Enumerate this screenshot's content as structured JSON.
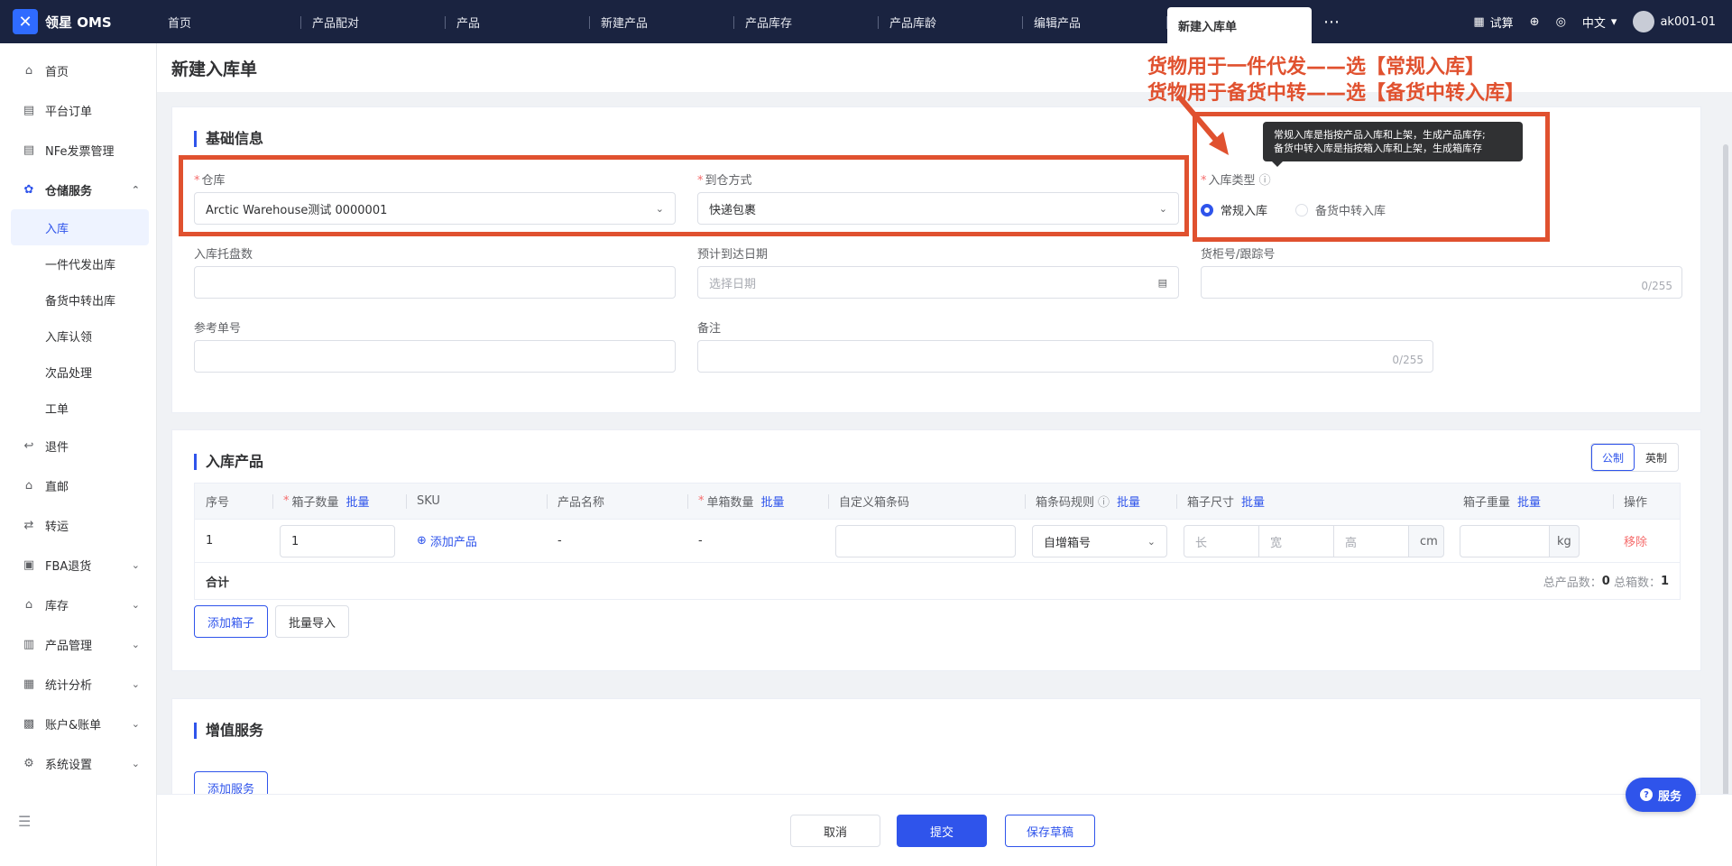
{
  "app": {
    "name": "领星 OMS"
  },
  "tabs": [
    "首页",
    "产品配对",
    "产品",
    "新建产品",
    "产品库存",
    "产品库龄",
    "编辑产品",
    "新建入库单"
  ],
  "active_tab": "新建入库单",
  "topbar": {
    "trial": "试算",
    "lang": "中文",
    "user": "ak001-01"
  },
  "sidebar": {
    "items": [
      {
        "label": "首页",
        "icon": "home-icon"
      },
      {
        "label": "平台订单",
        "icon": "doc-icon"
      },
      {
        "label": "NFe发票管理",
        "icon": "doc-icon"
      },
      {
        "label": "仓储服务",
        "icon": "warehouse-icon"
      }
    ],
    "sub_items": [
      "入库",
      "一件代发出库",
      "备货中转出库",
      "入库认领",
      "次品处理",
      "工单"
    ],
    "items_after": [
      {
        "label": "退件",
        "icon": "return-icon"
      },
      {
        "label": "直邮",
        "icon": "mail-icon"
      },
      {
        "label": "转运",
        "icon": "transfer-icon"
      },
      {
        "label": "FBA退货",
        "icon": "fba-icon"
      },
      {
        "label": "库存",
        "icon": "stock-icon"
      },
      {
        "label": "产品管理",
        "icon": "product-icon"
      },
      {
        "label": "统计分析",
        "icon": "stats-icon"
      },
      {
        "label": "账户&账单",
        "icon": "account-icon"
      },
      {
        "label": "系统设置",
        "icon": "settings-icon"
      }
    ]
  },
  "page": {
    "title": "新建入库单"
  },
  "basic": {
    "title": "基础信息",
    "warehouse_label": "仓库",
    "warehouse_value": "Arctic Warehouse测试 0000001",
    "arrival_label": "到仓方式",
    "arrival_value": "快递包裹",
    "type_label": "入库类型",
    "type_options": [
      "常规入库",
      "备货中转入库"
    ],
    "type_selected": "常规入库",
    "pallet_label": "入库托盘数",
    "date_label": "预计到达日期",
    "date_placeholder": "选择日期",
    "tracking_label": "货柜号/跟踪号",
    "tracking_counter": "0/255",
    "ref_label": "参考单号",
    "remark_label": "备注",
    "remark_counter": "0/255"
  },
  "tooltip": {
    "line1": "常规入库是指按产品入库和上架，生成产品库存;",
    "line2": "备货中转入库是指按箱入库和上架，生成箱库存"
  },
  "annotation": {
    "line1": "货物用于一件代发——选【常规入库】",
    "line2": "货物用于备货中转——选【备货中转入库】"
  },
  "products": {
    "title": "入库产品",
    "unit_metric": "公制",
    "unit_imperial": "英制",
    "headers": {
      "index": "序号",
      "box_qty": "箱子数量",
      "batch": "批量",
      "sku": "SKU",
      "name": "产品名称",
      "per_box": "单箱数量",
      "barcode": "自定义箱条码",
      "rule": "箱条码规则",
      "size": "箱子尺寸",
      "weight": "箱子重量",
      "action": "操作"
    },
    "row": {
      "index": "1",
      "box_qty": "1",
      "add_product": "添加产品",
      "name": "-",
      "per_box": "-",
      "rule": "自增箱号",
      "len_ph": "长",
      "wid_ph": "宽",
      "hei_ph": "高",
      "size_unit": "cm",
      "weight_unit": "kg",
      "remove": "移除"
    },
    "sum_label": "合计",
    "sum_text_a": "总产品数：",
    "sum_val_a": "0",
    "sum_text_b": "总箱数：",
    "sum_val_b": "1",
    "add_box": "添加箱子",
    "bulk_import": "批量导入"
  },
  "value_added": {
    "title": "增值服务",
    "add_service": "添加服务"
  },
  "footer": {
    "cancel": "取消",
    "submit": "提交",
    "save_draft": "保存草稿"
  },
  "service_button": "服务",
  "colors": {
    "accent": "#2f54eb",
    "annotation": "#e0512f",
    "topbar": "#1a2340"
  }
}
